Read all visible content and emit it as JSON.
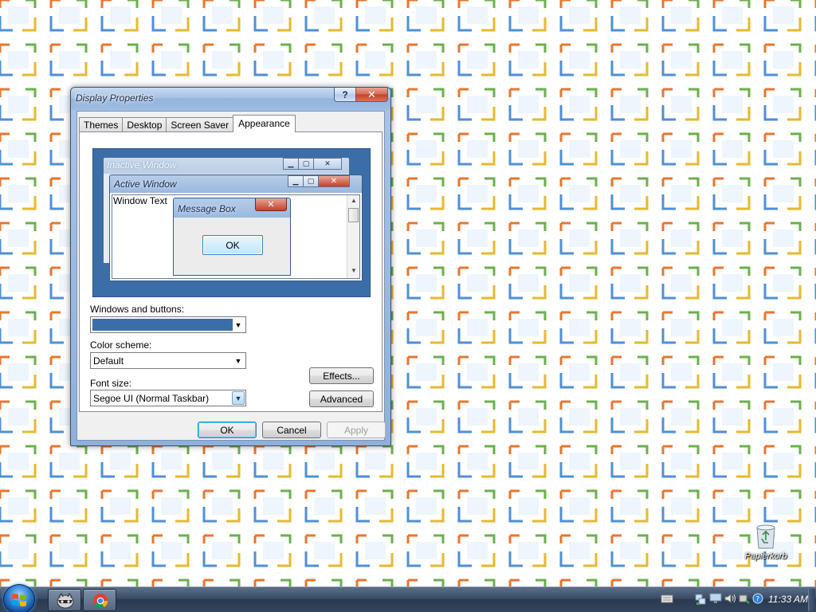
{
  "dialog": {
    "title": "Display Properties",
    "help_glyph": "?",
    "close_glyph": "✕",
    "tabs": [
      {
        "label": "Themes"
      },
      {
        "label": "Desktop"
      },
      {
        "label": "Screen Saver"
      },
      {
        "label": "Appearance"
      }
    ],
    "active_tab": "Appearance",
    "preview": {
      "inactive_window_title": "Inactive Window",
      "active_window_title": "Active Window",
      "window_text": "Window Text",
      "message_box_title": "Message Box",
      "message_box_ok": "OK"
    },
    "windows_and_buttons": {
      "label": "Windows and buttons:",
      "value_color": "#3b6ea8"
    },
    "color_scheme": {
      "label": "Color scheme:",
      "value": "Default"
    },
    "font_size": {
      "label": "Font size:",
      "value": "Segoe UI (Normal Taskbar)"
    },
    "effects_button": "Effects...",
    "advanced_button": "Advanced",
    "ok_button": "OK",
    "cancel_button": "Cancel",
    "apply_button": "Apply"
  },
  "desktop": {
    "recycle_bin_label": "Papierkorb"
  },
  "taskbar": {
    "start_icon": "windows-logo-icon",
    "pinned": [
      {
        "name": "raccoon-app-icon"
      },
      {
        "name": "chrome-icon"
      }
    ],
    "tray_icons": [
      "keyboard-icon",
      "network-icon",
      "monitor-icon",
      "volume-icon",
      "safely-remove-icon",
      "help-circle-icon"
    ],
    "clock": "11:33 AM"
  },
  "colors": {
    "accent_blue": "#3b6ea8",
    "close_red": "#c4412a",
    "wallpaper_orange": "#e8762f",
    "wallpaper_green": "#6ab04c",
    "wallpaper_blue": "#4f8fd6",
    "wallpaper_yellow": "#e6b92e"
  }
}
